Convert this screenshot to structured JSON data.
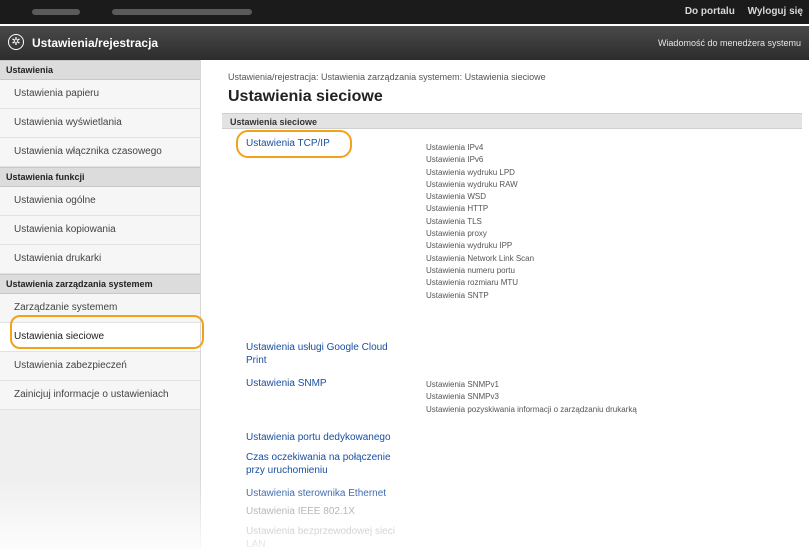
{
  "topbar": {
    "portal_link": "Do portalu",
    "logout_link": "Wyloguj się"
  },
  "header": {
    "title": "Ustawienia/rejestracja",
    "message_link": "Wiadomość do menedżera systemu"
  },
  "sidebar": {
    "sections": [
      {
        "label": "Ustawienia",
        "items": [
          "Ustawienia papieru",
          "Ustawienia wyświetlania",
          "Ustawienia włącznika czasowego"
        ]
      },
      {
        "label": "Ustawienia funkcji",
        "items": [
          "Ustawienia ogólne",
          "Ustawienia kopiowania",
          "Ustawienia drukarki"
        ]
      },
      {
        "label": "Ustawienia zarządzania systemem",
        "items": [
          "Zarządzanie systemem",
          "Ustawienia sieciowe",
          "Ustawienia zabezpieczeń",
          "Zainicjuj informacje o ustawieniach"
        ]
      }
    ],
    "active_item": "Ustawienia sieciowe"
  },
  "main": {
    "breadcrumb": "Ustawienia/rejestracja: Ustawienia zarządzania systemem: Ustawienia sieciowe",
    "title": "Ustawienia sieciowe",
    "section_header": "Ustawienia sieciowe",
    "tcpip_link": "Ustawienia TCP/IP",
    "tcpip_subitems": [
      "Ustawienia IPv4",
      "Ustawienia IPv6",
      "Ustawienia wydruku LPD",
      "Ustawienia wydruku RAW",
      "Ustawienia WSD",
      "Ustawienia HTTP",
      "Ustawienia TLS",
      "Ustawienia proxy",
      "Ustawienia wydruku IPP",
      "Ustawienia Network Link Scan",
      "Ustawienia numeru portu",
      "Ustawienia rozmiaru MTU",
      "Ustawienia SNTP"
    ],
    "google_link_line1": "Ustawienia usługi Google Cloud",
    "google_link_line2": "Print",
    "snmp_link": "Ustawienia SNMP",
    "snmp_subitems": [
      "Ustawienia SNMPv1",
      "Ustawienia SNMPv3",
      "Ustawienia pozyskiwania informacji o zarządzaniu drukarką"
    ],
    "dedicated_port_link": "Ustawienia portu dedykowanego",
    "wait_link_line1": "Czas oczekiwania na połączenie",
    "wait_link_line2": "przy uruchomieniu",
    "ethernet_link": "Ustawienia sterownika Ethernet",
    "ieee_link": "Ustawienia IEEE 802.1X",
    "wireless_link_line1": "Ustawienia bezprzewodowej sieci",
    "wireless_link_line2": "LAN"
  }
}
